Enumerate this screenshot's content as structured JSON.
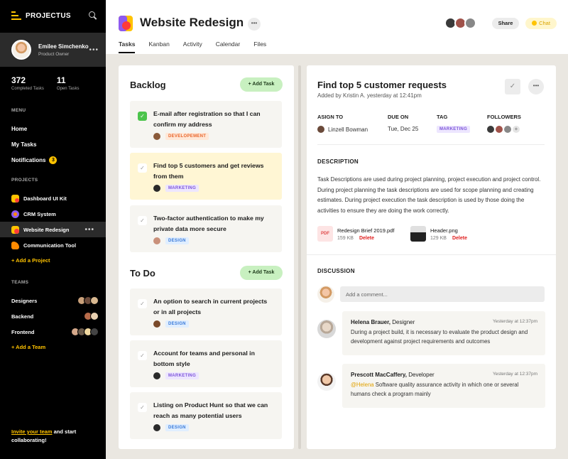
{
  "sidebar": {
    "brand": "PROJECTUS",
    "user": {
      "name": "Emilee Simchenko",
      "role": "Product Owner"
    },
    "stats": [
      {
        "num": "372",
        "label": "Completed Tasks"
      },
      {
        "num": "11",
        "label": "Open Tasks"
      }
    ],
    "menu_title": "MENU",
    "menu": [
      {
        "label": "Home"
      },
      {
        "label": "My Tasks"
      },
      {
        "label": "Notifications",
        "badge": "3"
      }
    ],
    "projects_title": "PROJECTS",
    "projects": [
      {
        "label": "Dashboard UI Kit",
        "color": "#ffc300"
      },
      {
        "label": "CRM System",
        "color": "#8e5af0"
      },
      {
        "label": "Website Redesign",
        "color": "#ffc300"
      },
      {
        "label": "Communication Tool",
        "color": "#ff8a00"
      }
    ],
    "add_project": "+ Add a Project",
    "teams_title": "TEAMS",
    "teams": [
      {
        "label": "Designers"
      },
      {
        "label": "Backend"
      },
      {
        "label": "Frontend"
      }
    ],
    "add_team": "+ Add a Team",
    "invite_highlight": "Invite your team",
    "invite_rest": " and start collaborating!"
  },
  "header": {
    "title": "Website Redesign",
    "more": "•••",
    "share": "Share",
    "chat": "Chat",
    "tabs": [
      "Tasks",
      "Kanban",
      "Activity",
      "Calendar",
      "Files"
    ]
  },
  "tasks": {
    "backlog": {
      "title": "Backlog",
      "add": "+ Add Task",
      "cards": [
        {
          "text": "E-mail after registration so that I can confirm my address",
          "tag": "DEVELOPEMENT",
          "done": true
        },
        {
          "text": "Find top 5 customers and get reviews from them",
          "tag": "MARKETING",
          "done": false
        },
        {
          "text": "Two-factor authentication to make my private data more secure",
          "tag": "DESIGN",
          "done": false
        }
      ]
    },
    "todo": {
      "title": "To Do",
      "add": "+ Add Task",
      "cards": [
        {
          "text": "An option to search in current projects or in all projects",
          "tag": "DESIGN"
        },
        {
          "text": "Account for teams and personal in bottom style",
          "tag": "MARKETING"
        },
        {
          "text": "Listing on Product Hunt so that we can reach as many potential users",
          "tag": "DESIGN"
        }
      ]
    }
  },
  "detail": {
    "title": "Find top 5 customer requests",
    "subtitle": "Added by Kristin A. yesterday at 12:41pm",
    "fields": {
      "assign_label": "ASIGN TO",
      "assignee": "Linzell Bowman",
      "due_label": "DUE ON",
      "due": "Tue, Dec 25",
      "tag_label": "TAG",
      "tag": "MARKETING",
      "followers_label": "FOLLOWERS",
      "followers_plus": "+"
    },
    "description_title": "DESCRIPTION",
    "description": "Task Descriptions are used during project planning, project execution and project control. During project planning the task descriptions are used for scope planning and creating estimates. During project execution the task description is used by those doing the activities to ensure they are doing the work correctly.",
    "attachments": [
      {
        "icon": "PDF",
        "name": "Redesign Brief 2019.pdf",
        "size": "159 KB",
        "delete": "Delete"
      },
      {
        "name": "Header.png",
        "size": "129 KB",
        "delete": "Delete"
      }
    ],
    "discussion_title": "DISCUSSION",
    "comment_placeholder": "Add a comment...",
    "comments": [
      {
        "name": "Helena Brauer,",
        "role": " Designer",
        "time": "Yesterday at 12:37pm",
        "mention": "",
        "text": "During a project build, it is necessary to evaluate the product design and development against project requirements and outcomes"
      },
      {
        "name": "Prescott MacCaffery,",
        "role": " Developer",
        "time": "Yesterday at 12:37pm",
        "mention": "@Helena",
        "text": " Software quality assurance activity in which one or several humans check a program mainly"
      }
    ]
  },
  "colors": {
    "accent": "#ffc300",
    "green": "#4cc44c",
    "purple": "#7c54d8",
    "red": "#e02020"
  }
}
